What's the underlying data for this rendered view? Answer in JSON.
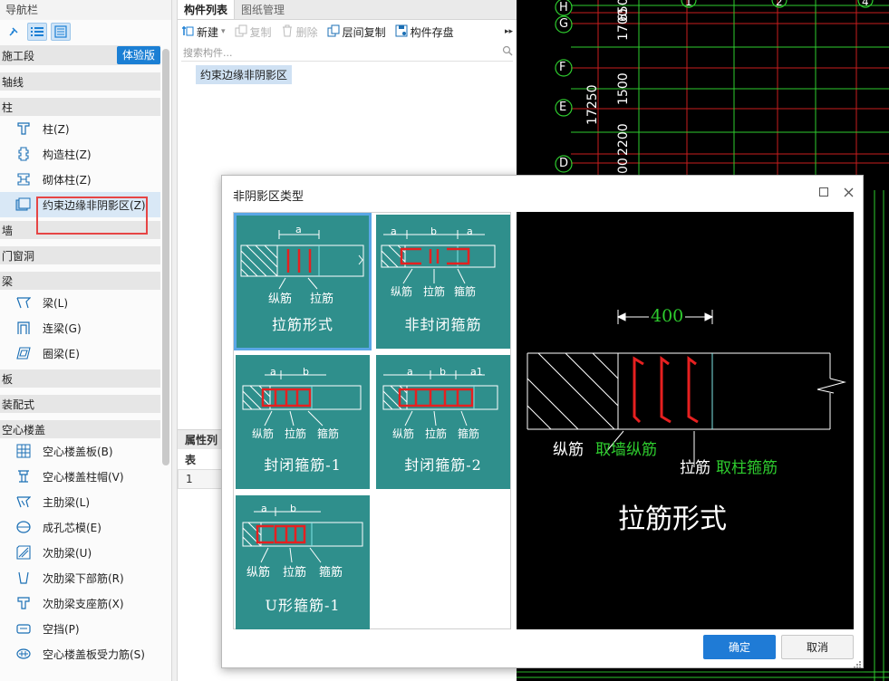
{
  "nav": {
    "title": "导航栏",
    "experience_badge": "体验版",
    "groups": {
      "stage": "施工段",
      "axis": "轴线",
      "column": "柱",
      "wall": "墙",
      "door_window": "门窗洞",
      "beam": "梁",
      "slab": "板",
      "prefab": "装配式",
      "hollow": "空心楼盖"
    },
    "column_items": [
      "柱(Z)",
      "构造柱(Z)",
      "砌体柱(Z)",
      "约束边缘非阴影区(Z)"
    ],
    "beam_items": [
      "梁(L)",
      "连梁(G)",
      "圈梁(E)"
    ],
    "hollow_items": [
      "空心楼盖板(B)",
      "空心楼盖柱帽(V)",
      "主肋梁(L)",
      "成孔芯模(E)",
      "次肋梁(U)",
      "次肋梁下部筋(R)",
      "次肋梁支座筋(X)",
      "空挡(P)",
      "空心楼盖板受力筋(S)"
    ]
  },
  "component_panel": {
    "tabs": [
      "构件列表",
      "图纸管理"
    ],
    "toolbar": {
      "new": "新建",
      "copy": "复制",
      "delete": "删除",
      "floor_copy": "层间复制",
      "save": "构件存盘"
    },
    "search_placeholder": "搜索构件...",
    "component_item": "约束边缘非阴影区",
    "prop_header": "属性列表",
    "prop_row_index": "1"
  },
  "cad": {
    "axis_labels": [
      "H",
      "G",
      "F",
      "E",
      "D"
    ],
    "column_numbers": [
      "1",
      "2",
      "4"
    ],
    "dimensions": [
      "1700",
      "650",
      "1500",
      "2200",
      "17250",
      "00"
    ]
  },
  "dialog": {
    "title": "非阴影区类型",
    "tiles": [
      {
        "name": "拉筋形式",
        "labels": [
          "纵筋",
          "拉筋"
        ],
        "dims": [
          "a"
        ]
      },
      {
        "name": "非封闭箍筋",
        "labels": [
          "纵筋",
          "拉筋",
          "箍筋"
        ],
        "dims": [
          "a",
          "b",
          "a"
        ]
      },
      {
        "name": "封闭箍筋-1",
        "labels": [
          "纵筋",
          "拉筋",
          "箍筋"
        ],
        "dims": [
          "a",
          "b"
        ]
      },
      {
        "name": "封闭箍筋-2",
        "labels": [
          "纵筋",
          "拉筋",
          "箍筋"
        ],
        "dims": [
          "a",
          "b",
          "a1"
        ]
      },
      {
        "name": "U形箍筋-1",
        "labels": [
          "纵筋",
          "拉筋",
          "箍筋"
        ],
        "dims": [
          "a",
          "b"
        ]
      }
    ],
    "preview": {
      "dimension": "400",
      "label_long": "纵筋",
      "label_long_note": "取墙纵筋",
      "label_tie": "拉筋",
      "label_tie_note": "取柱箍筋",
      "caption": "拉筋形式"
    },
    "ok": "确定",
    "cancel": "取消"
  },
  "colors": {
    "accent": "#1f7bd6",
    "tile": "#2f8f8c",
    "highlight": "#e64545",
    "cad_green": "#2ecc2e",
    "rebar_red": "#e62020"
  }
}
